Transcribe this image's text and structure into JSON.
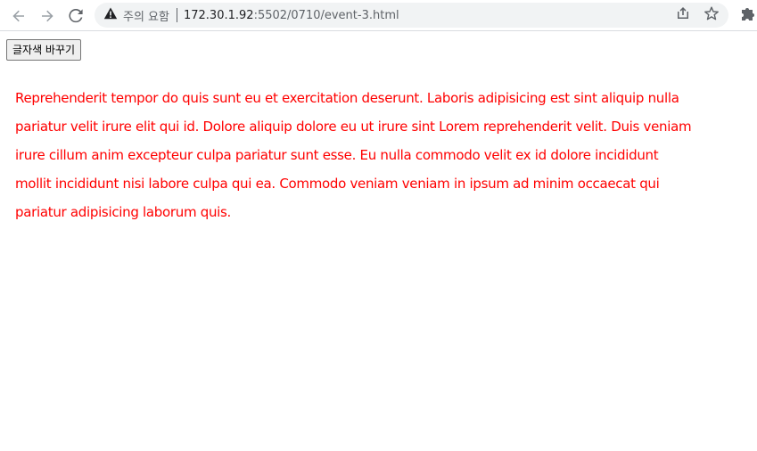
{
  "browser": {
    "security_label": "주의 요함",
    "url_host": "172.30.1.92",
    "url_path": ":5502/0710/event-3.html",
    "icons": {
      "back": "arrow-left-icon",
      "forward": "arrow-right-icon",
      "reload": "reload-icon",
      "warning": "warning-icon",
      "share": "share-icon",
      "bookmark": "star-icon",
      "extensions": "puzzle-icon"
    }
  },
  "page": {
    "button_label": "글자색 바꾸기",
    "paragraph": "Reprehenderit tempor do quis sunt eu et exercitation deserunt. Laboris adipisicing est sint aliquip nulla pariatur velit irure elit qui id. Dolore aliquip dolore eu ut irure sint Lorem reprehenderit velit. Duis veniam irure cillum anim excepteur culpa pariatur sunt esse. Eu nulla commodo velit ex id dolore incididunt mollit incididunt nisi labore culpa qui ea. Commodo veniam veniam in ipsum ad minim occaecat qui pariatur adipisicing laborum quis.",
    "text_color": "#ff0000"
  },
  "colors": {
    "toolbar_bg": "#ffffff",
    "omnibox_bg": "#f1f3f4",
    "icon": "#5f6368",
    "disabled_icon": "#9aa0a6"
  }
}
